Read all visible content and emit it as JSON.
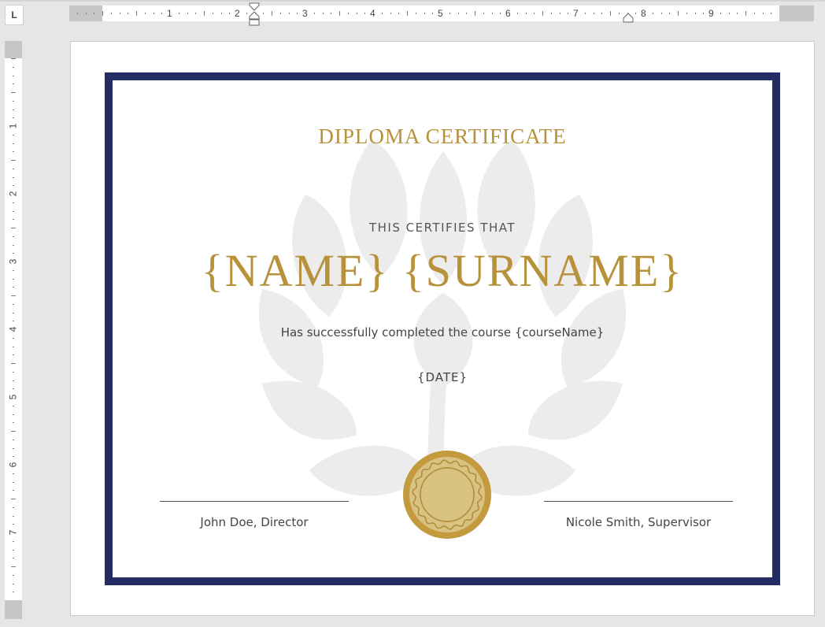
{
  "ruler": {
    "tab_selector_glyph": "L",
    "horizontal_numbers": [
      "1",
      "2",
      "3",
      "4",
      "5",
      "6",
      "7",
      "8",
      "9"
    ],
    "vertical_numbers": [
      "1",
      "2",
      "3",
      "4",
      "5",
      "6",
      "7"
    ]
  },
  "certificate": {
    "title": "DIPLOMA CERTIFICATE",
    "certifies": "THIS CERTIFIES THAT",
    "recipient": "{NAME} {SURNAME}",
    "course_line": "Has successfully completed the course {courseName}",
    "date": "{DATE}",
    "signatory_left": "John Doe, Director",
    "signatory_right": "Nicole Smith, Supervisor"
  },
  "colors": {
    "border": "#232c63",
    "gold": "#b8913b",
    "seal_fill": "#d9c181",
    "watermark": "#ececec"
  },
  "icons": [
    "tab-selector-icon",
    "first-line-indent-marker-icon",
    "right-indent-marker-icon",
    "laurel-watermark",
    "gold-seal"
  ]
}
